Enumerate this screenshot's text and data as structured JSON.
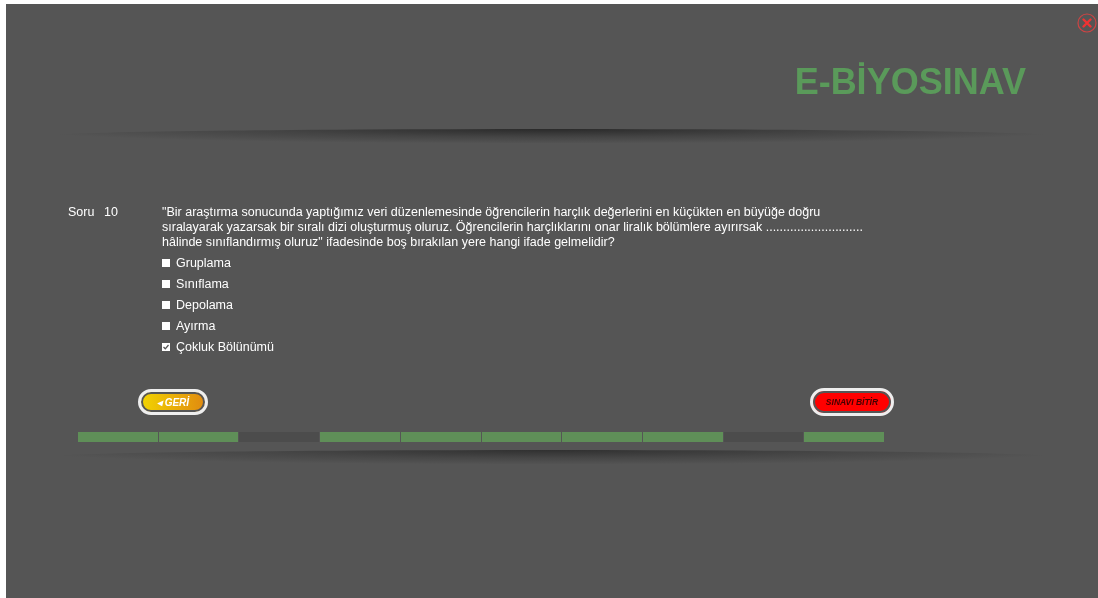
{
  "logo": {
    "text": "E-BİYOSINAV"
  },
  "question": {
    "label": "Soru",
    "number": "10",
    "text": "\"Bir araştırma sonucunda yaptığımız veri düzenlemesinde öğrencilerin harçlık değerlerini en küçükten en büyüğe doğru sıralayarak yazarsak bir sıralı dizi oluşturmuş oluruz. Öğrencilerin harçlıklarını onar liralık bölümlere ayırırsak ............................ hâlinde sınıflandırmış oluruz\"   ifadesinde boş bırakılan yere hangi ifade gelmelidir?"
  },
  "options": [
    {
      "label": "Gruplama",
      "checked": false
    },
    {
      "label": "Sınıflama",
      "checked": false
    },
    {
      "label": "Depolama",
      "checked": false
    },
    {
      "label": "Ayırma",
      "checked": false
    },
    {
      "label": "Çokluk Bölünümü",
      "checked": true
    }
  ],
  "buttons": {
    "back": "◂ GERİ",
    "finish": "SINAVI BİTİR"
  },
  "progress": [
    {
      "answered": true
    },
    {
      "answered": true
    },
    {
      "answered": false
    },
    {
      "answered": true
    },
    {
      "answered": true
    },
    {
      "answered": true
    },
    {
      "answered": true
    },
    {
      "answered": true
    },
    {
      "answered": false
    },
    {
      "answered": true
    }
  ]
}
